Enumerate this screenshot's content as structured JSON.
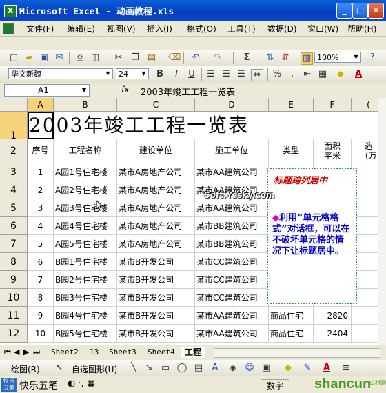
{
  "window": {
    "title": "Microsoft Excel - 动画教程.xls",
    "app_icon": "excel-icon"
  },
  "menu": [
    "文件(F)",
    "编辑(E)",
    "视图(V)",
    "插入(I)",
    "格式(O)",
    "工具(T)",
    "数据(D)",
    "窗口(W)",
    "帮助(H)"
  ],
  "toolbar": {
    "zoom": "100%"
  },
  "format": {
    "font": "华文新魏",
    "size": "24",
    "bold": "B",
    "italic": "I",
    "underline": "U"
  },
  "formula": {
    "cell": "A1",
    "fx": "fx",
    "value": "2003年竣工工程一览表"
  },
  "sheet": {
    "columns": [
      "A",
      "B",
      "C",
      "D",
      "E",
      "F",
      "("
    ],
    "title": "2003年竣工工程一览表",
    "headers": {
      "a": "序号",
      "b": "工程名称",
      "c": "建设单位",
      "d": "施工单位",
      "e": "类型",
      "f": "面积\n平米",
      "g": "造\n（万"
    },
    "rows": [
      {
        "n": "1",
        "num": "1",
        "name": "A园1号住宅楼",
        "builder": "某市A房地产公司",
        "contractor": "某市AA建筑公司",
        "type": "",
        "area": ""
      },
      {
        "n": "2",
        "num": "2",
        "name": "A园2号住宅楼",
        "builder": "某市A房地产公司",
        "contractor": "某市AA建筑公司",
        "type": "",
        "area": ""
      },
      {
        "n": "3",
        "num": "3",
        "name": "A园3号住宅楼",
        "builder": "某市A房地产公司",
        "contractor": "某市AA建筑公司",
        "type": "",
        "area": ""
      },
      {
        "n": "4",
        "num": "4",
        "name": "A园4号住宅楼",
        "builder": "某市A房地产公司",
        "contractor": "某市BB建筑公司",
        "type": "",
        "area": ""
      },
      {
        "n": "5",
        "num": "5",
        "name": "A园5号住宅楼",
        "builder": "某市A房地产公司",
        "contractor": "某市BB建筑公司",
        "type": "",
        "area": ""
      },
      {
        "n": "6",
        "num": "6",
        "name": "B园1号住宅楼",
        "builder": "某市B开发公司",
        "contractor": "某市CC建筑公司",
        "type": "",
        "area": ""
      },
      {
        "n": "7",
        "num": "7",
        "name": "B园2号住宅楼",
        "builder": "某市B开发公司",
        "contractor": "某市CC建筑公司",
        "type": "",
        "area": ""
      },
      {
        "n": "8",
        "num": "8",
        "name": "B园3号住宅楼",
        "builder": "某市B开发公司",
        "contractor": "某市CC建筑公司",
        "type": "",
        "area": ""
      },
      {
        "n": "9",
        "num": "9",
        "name": "B园4号住宅楼",
        "builder": "某市B开发公司",
        "contractor": "某市AA建筑公司",
        "type": "商品住宅",
        "area": "2820"
      },
      {
        "n": "10",
        "num": "10",
        "name": "B园5号住宅楼",
        "builder": "某市B开发公司",
        "contractor": "某市AA建筑公司",
        "type": "商品住宅",
        "area": "2404"
      }
    ],
    "row_numbers": [
      "1",
      "2",
      "3",
      "4",
      "5",
      "6",
      "7",
      "8",
      "9",
      "10",
      "11",
      "12"
    ]
  },
  "callout": {
    "title": "标题跨列居中",
    "bullet": "◆",
    "text": "利用“单元格格式”对话框，可以在不破坏单元格的情况下让标题居中。"
  },
  "watermark": "Soft.Yesky.com",
  "tabs": [
    "Sheet2",
    "13",
    "Sheet3",
    "Sheet4",
    "工程"
  ],
  "drawing": {
    "draw": "绘图(R)",
    "autoshapes": "自选图形(U)"
  },
  "status": {
    "ime": "快乐五笔",
    "mode": "数字",
    "brand": "shancun",
    "brand_sub": "山村网"
  }
}
